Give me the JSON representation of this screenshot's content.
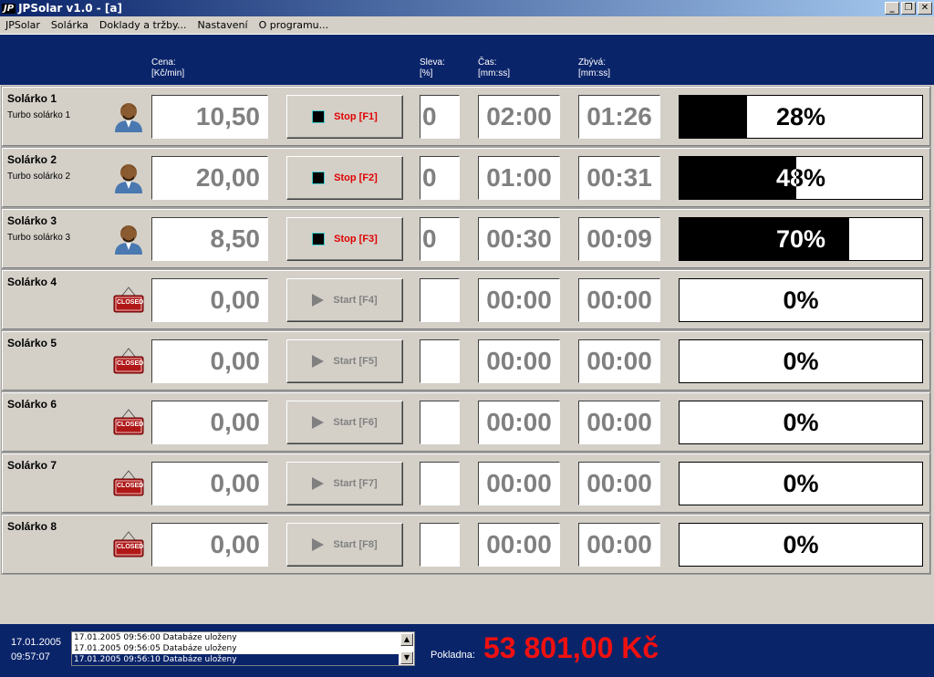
{
  "window": {
    "logo": "JP",
    "title": "JPSolar v1.0 - [a]",
    "min": "_",
    "max": "❐",
    "close": "✕"
  },
  "menu": [
    "JPSolar",
    "Solárka",
    "Doklady a tržby...",
    "Nastavení",
    "O programu..."
  ],
  "columns": {
    "price": "Cena:",
    "price_unit": "[Kč/min]",
    "discount": "Sleva:",
    "discount_unit": "[%]",
    "time": "Čas:",
    "time_unit": "[mm:ss]",
    "remaining": "Zbývá:",
    "remaining_unit": "[mm:ss]"
  },
  "rows": [
    {
      "name": "Solárko 1",
      "sub": "Turbo solárko 1",
      "status": "busy",
      "price": "10,50",
      "button": "Stop [F1]",
      "discount": "0",
      "time": "02:00",
      "remaining": "01:26",
      "progress": 28,
      "progress_label": "28%"
    },
    {
      "name": "Solárko 2",
      "sub": "Turbo solárko 2",
      "status": "busy",
      "price": "20,00",
      "button": "Stop [F2]",
      "discount": "0",
      "time": "01:00",
      "remaining": "00:31",
      "progress": 48,
      "progress_label": "48%"
    },
    {
      "name": "Solárko 3",
      "sub": "Turbo solárko 3",
      "status": "busy",
      "price": "8,50",
      "button": "Stop [F3]",
      "discount": "0",
      "time": "00:30",
      "remaining": "00:09",
      "progress": 70,
      "progress_label": "70%"
    },
    {
      "name": "Solárko 4",
      "sub": "",
      "status": "closed",
      "price": "0,00",
      "button": "Start [F4]",
      "discount": "",
      "time": "00:00",
      "remaining": "00:00",
      "progress": 0,
      "progress_label": "0%"
    },
    {
      "name": "Solárko 5",
      "sub": "",
      "status": "closed",
      "price": "0,00",
      "button": "Start [F5]",
      "discount": "",
      "time": "00:00",
      "remaining": "00:00",
      "progress": 0,
      "progress_label": "0%"
    },
    {
      "name": "Solárko 6",
      "sub": "",
      "status": "closed",
      "price": "0,00",
      "button": "Start [F6]",
      "discount": "",
      "time": "00:00",
      "remaining": "00:00",
      "progress": 0,
      "progress_label": "0%"
    },
    {
      "name": "Solárko 7",
      "sub": "",
      "status": "closed",
      "price": "0,00",
      "button": "Start [F7]",
      "discount": "",
      "time": "00:00",
      "remaining": "00:00",
      "progress": 0,
      "progress_label": "0%"
    },
    {
      "name": "Solárko 8",
      "sub": "",
      "status": "closed",
      "price": "0,00",
      "button": "Start [F8]",
      "discount": "",
      "time": "00:00",
      "remaining": "00:00",
      "progress": 0,
      "progress_label": "0%"
    }
  ],
  "closed_sign": "CLOSED",
  "footer": {
    "date": "17.01.2005",
    "time": "09:57:07",
    "log": [
      "17.01.2005 09:56:00 Databáze uloženy",
      "17.01.2005 09:56:05 Databáze uloženy",
      "17.01.2005 09:56:10 Databáze uloženy"
    ],
    "cash_label": "Pokladna:",
    "cash_total": "53 801,00 Kč"
  }
}
